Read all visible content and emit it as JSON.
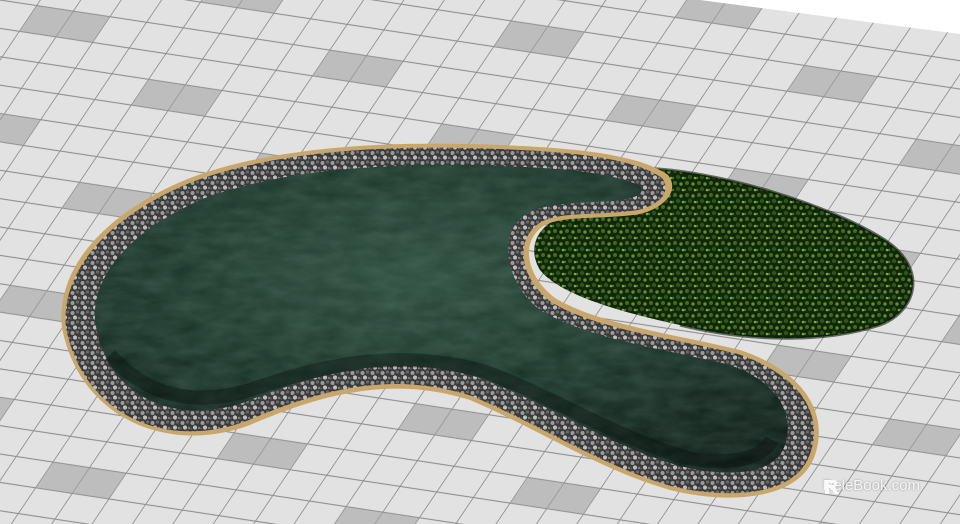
{
  "scene": {
    "description_kind": "3d-render",
    "colors": {
      "tile_light": "#e2e2e2",
      "tile_dark": "#9a9a9a",
      "grout": "#8d8d8d",
      "water_deep": "#0d1d17",
      "water_mid": "#1e3a2e",
      "gravel": "#3a3a3a",
      "coping": "#c9a76b",
      "shrub": "#1d3a14",
      "shrub_highlight": "#5e8f2c"
    }
  },
  "watermark": {
    "brand": "ReleBook",
    "suffix": ".com",
    "icon": "relebook-logo-icon"
  }
}
